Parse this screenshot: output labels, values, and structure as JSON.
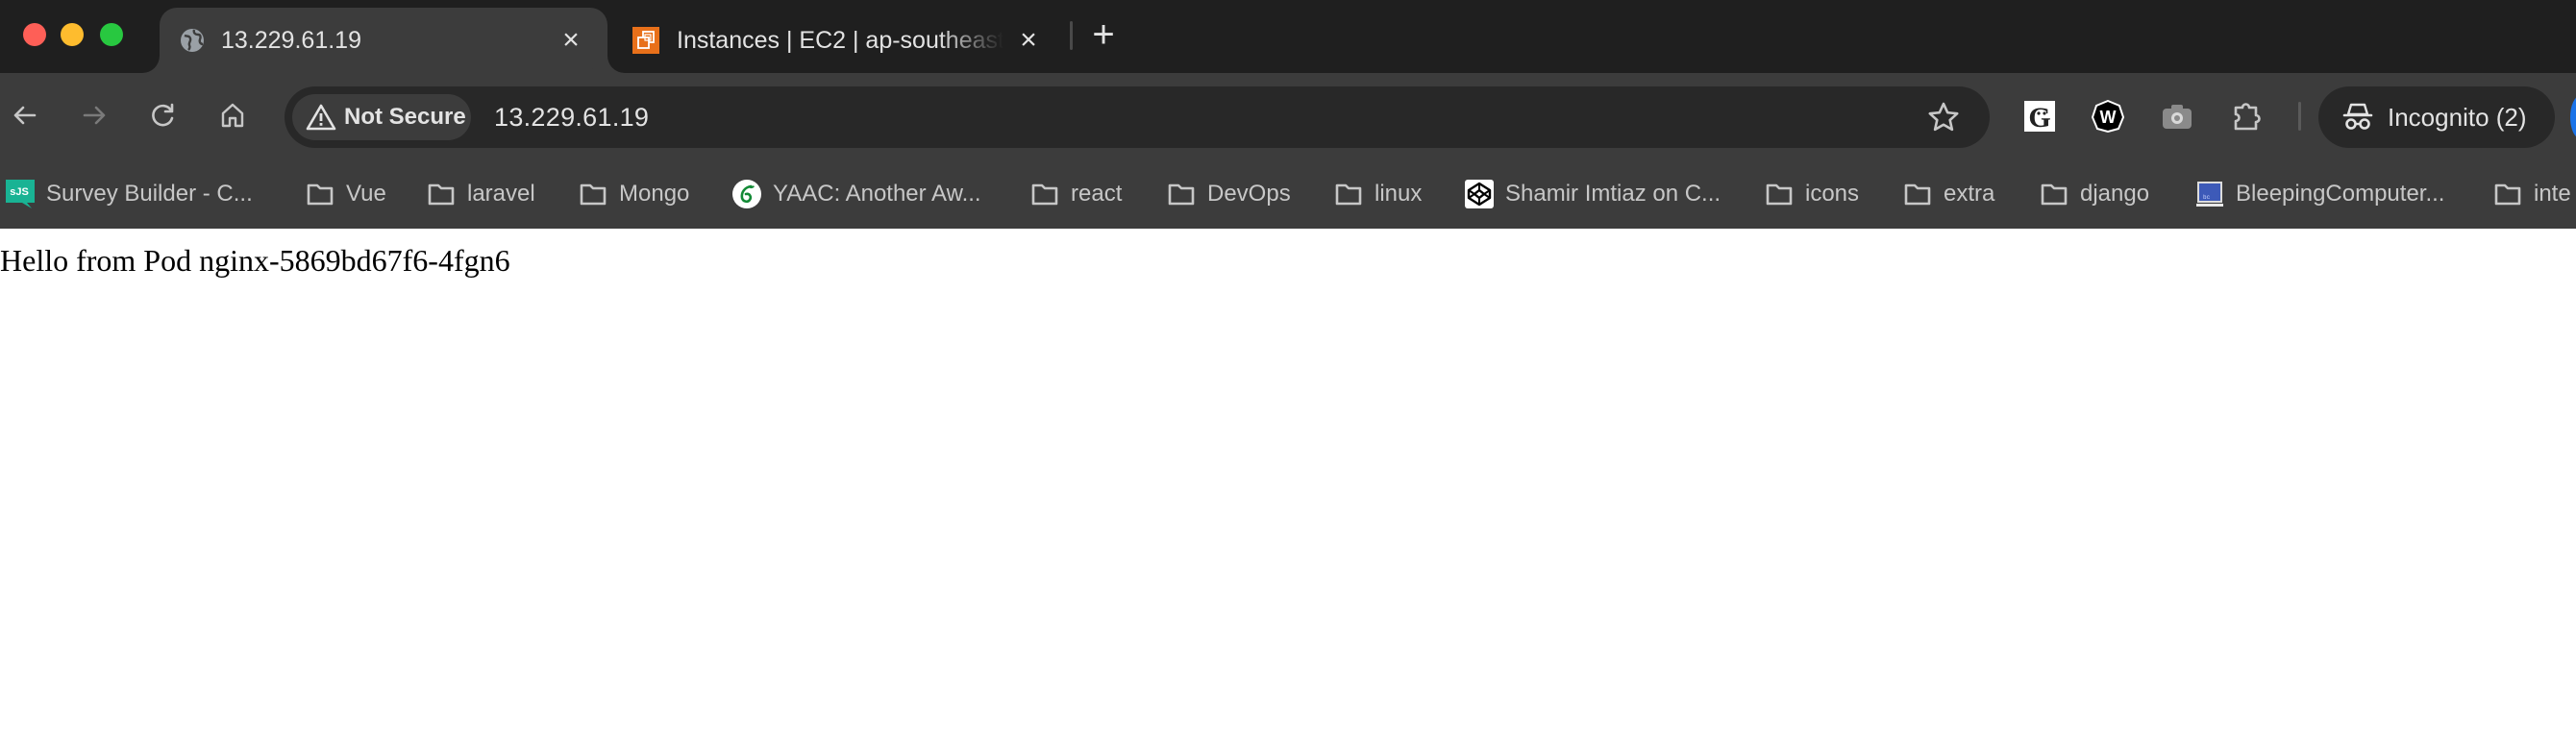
{
  "window": {
    "traffic_lights": [
      "close",
      "minimize",
      "maximize"
    ]
  },
  "tabs": [
    {
      "title": "13.229.61.19",
      "favicon": "globe-icon",
      "active": true,
      "close_label": "×"
    },
    {
      "title": "Instances | EC2 | ap-southeast",
      "favicon": "aws-ec2-icon",
      "active": false,
      "close_label": "×"
    }
  ],
  "new_tab_label": "+",
  "toolbar": {
    "security_label": "Not Secure",
    "url": "13.229.61.19",
    "extensions": [
      "grammar-extension-icon",
      "windscribe-extension-icon",
      "camera-extension-icon",
      "extensions-puzzle-icon"
    ],
    "profile_label": "Incognito (2)"
  },
  "bookmarks": [
    {
      "label": "Survey Builder - C...",
      "icon": "surveyjs-icon"
    },
    {
      "label": "Vue",
      "icon": "folder-icon"
    },
    {
      "label": "laravel",
      "icon": "folder-icon"
    },
    {
      "label": "Mongo",
      "icon": "folder-icon"
    },
    {
      "label": "YAAC: Another Aw...",
      "icon": "overleaf-icon"
    },
    {
      "label": "react",
      "icon": "folder-icon"
    },
    {
      "label": "DevOps",
      "icon": "folder-icon"
    },
    {
      "label": "linux",
      "icon": "folder-icon"
    },
    {
      "label": "Shamir Imtiaz on C...",
      "icon": "codepen-icon"
    },
    {
      "label": "icons",
      "icon": "folder-icon"
    },
    {
      "label": "extra",
      "icon": "folder-icon"
    },
    {
      "label": "django",
      "icon": "folder-icon"
    },
    {
      "label": "BleepingComputer...",
      "icon": "bleepingcomputer-icon"
    },
    {
      "label": "inte",
      "icon": "folder-icon"
    }
  ],
  "surveyjs_badge": "sJS",
  "page": {
    "body_text": "Hello from Pod nginx-5869bd67f6-4fgn6"
  },
  "colors": {
    "tabstrip_bg": "#1f1f1f",
    "toolbar_bg": "#3c3c3c",
    "omnibox_bg": "#282828",
    "aws_orange": "#e8701a",
    "surveyjs_green": "#19b394",
    "overleaf_green": "#138a36"
  }
}
